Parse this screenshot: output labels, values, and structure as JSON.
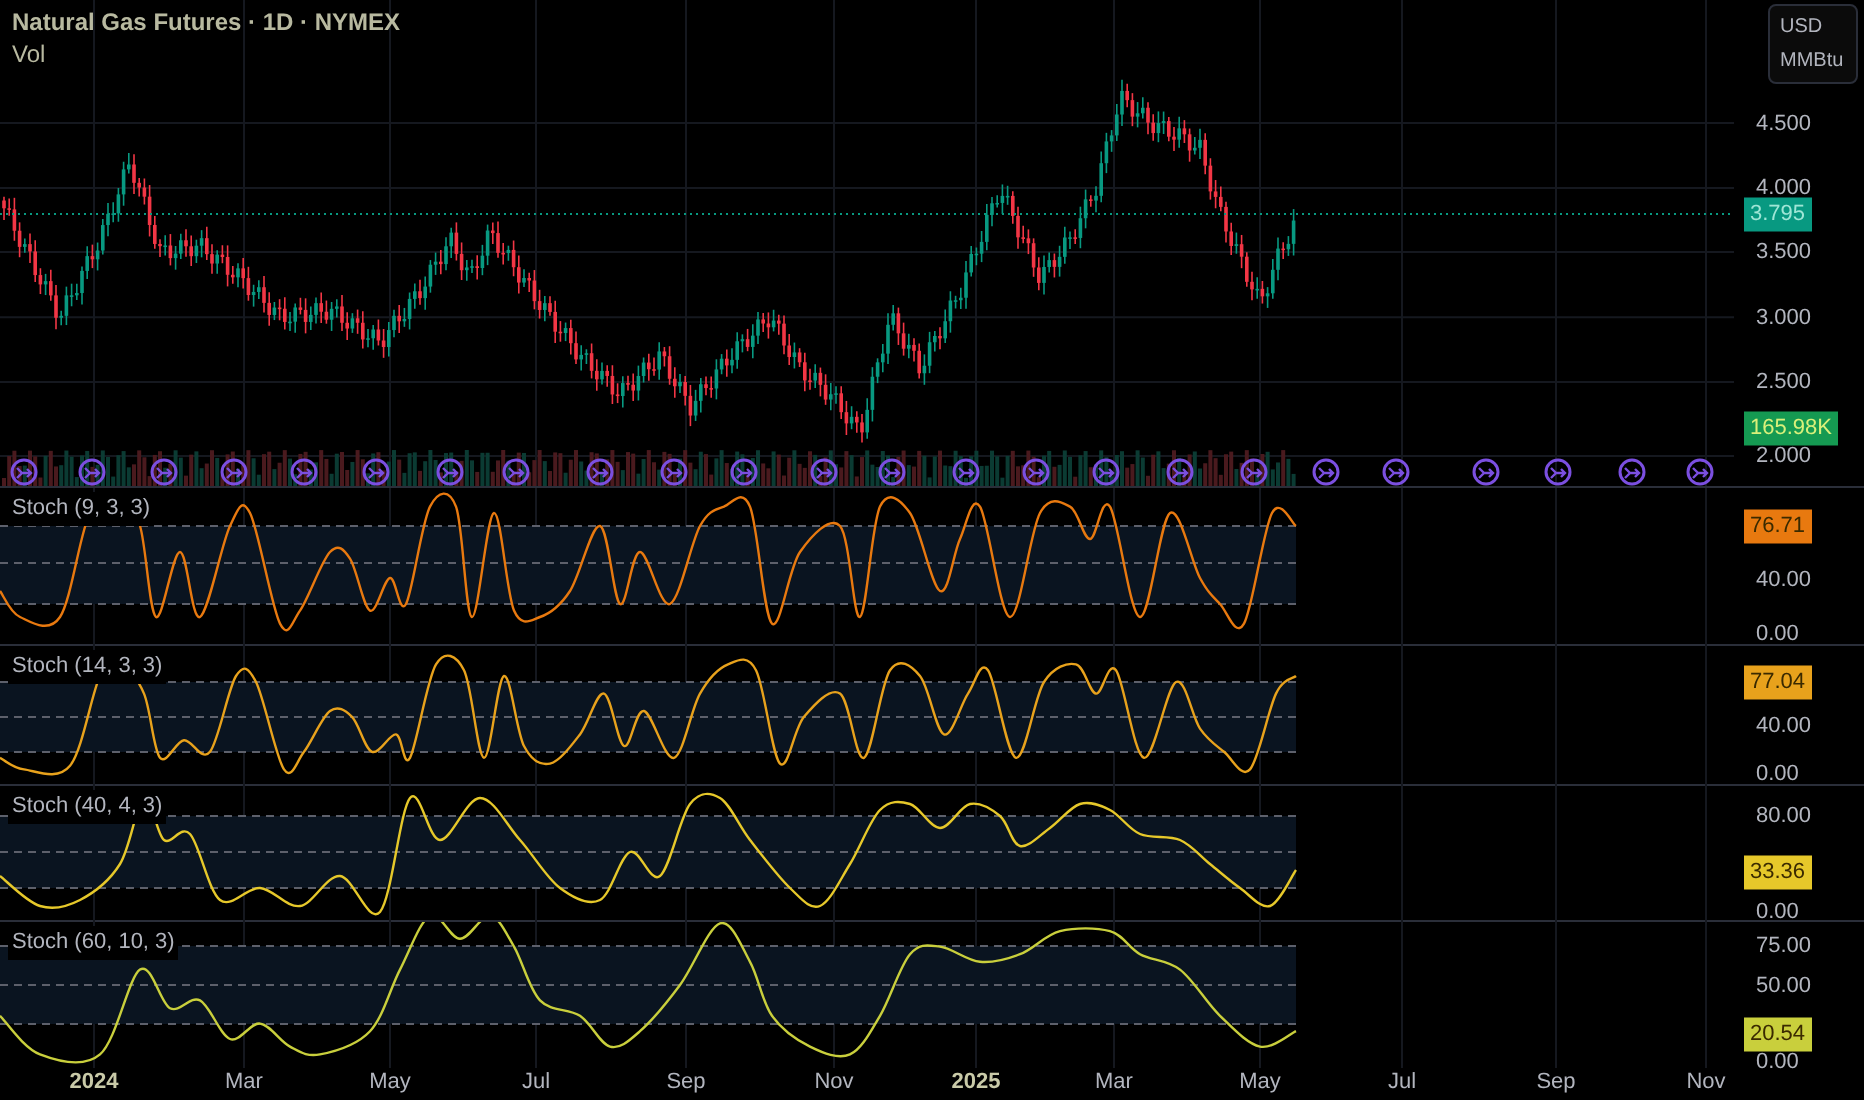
{
  "symbol": {
    "title": "Natural Gas Futures · 1D · NYMEX",
    "volume_label": "Vol"
  },
  "currency": {
    "unit": "USD",
    "measure": "MMBtu"
  },
  "price_axis": [
    "4.500",
    "4.000",
    "3.500",
    "3.000",
    "2.500",
    "2.000"
  ],
  "last_price": "3.795",
  "last_volume": "165.98K",
  "indicators": [
    {
      "name": "Stoch (9, 3, 3)",
      "color": "#e8790f",
      "value": "76.71",
      "ticks": [
        "40.00",
        "0.00"
      ]
    },
    {
      "name": "Stoch (14, 3, 3)",
      "color": "#e8a21c",
      "value": "77.04",
      "ticks": [
        "40.00",
        "0.00"
      ]
    },
    {
      "name": "Stoch (40, 4, 3)",
      "color": "#e6c82a",
      "value": "33.36",
      "ticks": [
        "80.00",
        "0.00"
      ]
    },
    {
      "name": "Stoch (60, 10, 3)",
      "color": "#c9cf3c",
      "value": "20.54",
      "ticks": [
        "75.00",
        "50.00",
        "0.00"
      ]
    }
  ],
  "time_axis": [
    {
      "label": "2024",
      "kind": "year"
    },
    {
      "label": "Mar",
      "kind": "month"
    },
    {
      "label": "May",
      "kind": "month"
    },
    {
      "label": "Jul",
      "kind": "month"
    },
    {
      "label": "Sep",
      "kind": "month"
    },
    {
      "label": "Nov",
      "kind": "month"
    },
    {
      "label": "2025",
      "kind": "year"
    },
    {
      "label": "Mar",
      "kind": "month"
    },
    {
      "label": "May",
      "kind": "month"
    },
    {
      "label": "Jul",
      "kind": "month"
    },
    {
      "label": "Sep",
      "kind": "month"
    },
    {
      "label": "Nov",
      "kind": "month"
    }
  ]
}
